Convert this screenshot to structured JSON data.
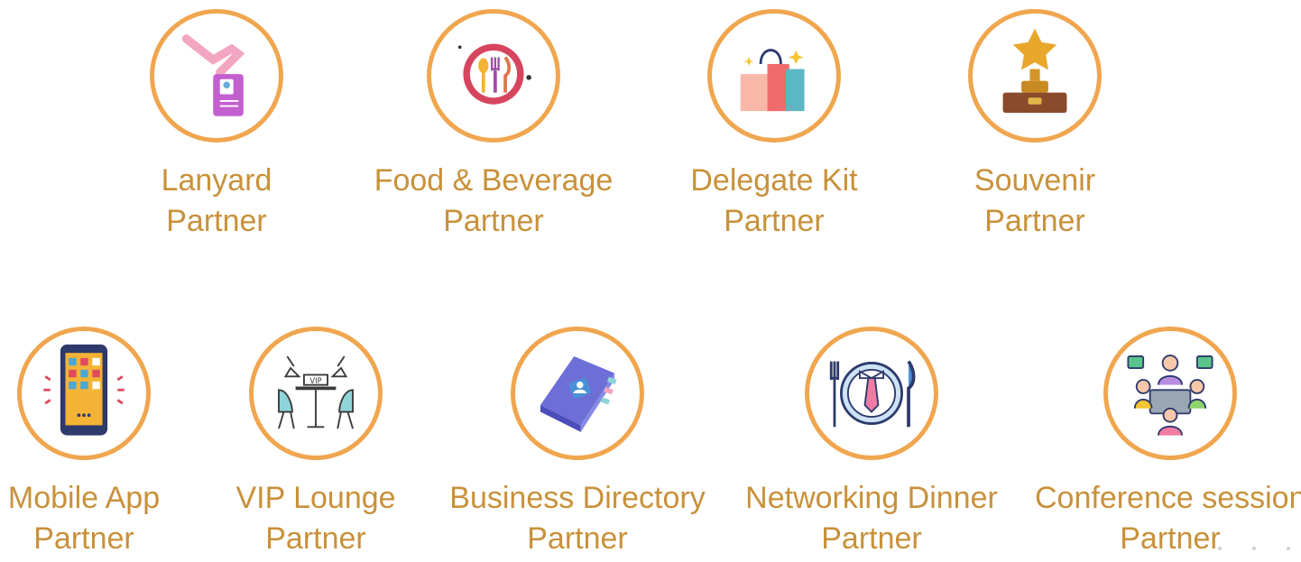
{
  "partners": [
    {
      "line1": "Lanyard",
      "line2": "Partner",
      "icon": "lanyard-icon"
    },
    {
      "line1": "Food & Beverage",
      "line2": "Partner",
      "icon": "food-plate-icon"
    },
    {
      "line1": "Delegate Kit",
      "line2": "Partner",
      "icon": "shopping-bags-icon"
    },
    {
      "line1": "Souvenir",
      "line2": "Partner",
      "icon": "trophy-star-icon"
    },
    {
      "line1": "Mobile App",
      "line2": "Partner",
      "icon": "mobile-app-icon"
    },
    {
      "line1": "VIP Lounge",
      "line2": "Partner",
      "icon": "vip-lounge-icon"
    },
    {
      "line1": "Business Directory",
      "line2": "Partner",
      "icon": "directory-book-icon"
    },
    {
      "line1": "Networking Dinner",
      "line2": "Partner",
      "icon": "dinner-plate-tie-icon"
    },
    {
      "line1": "Conference session",
      "line2": "Partner",
      "icon": "meeting-people-icon"
    }
  ],
  "colors": {
    "ring": "#f0a64f",
    "label": "#c8913a"
  }
}
